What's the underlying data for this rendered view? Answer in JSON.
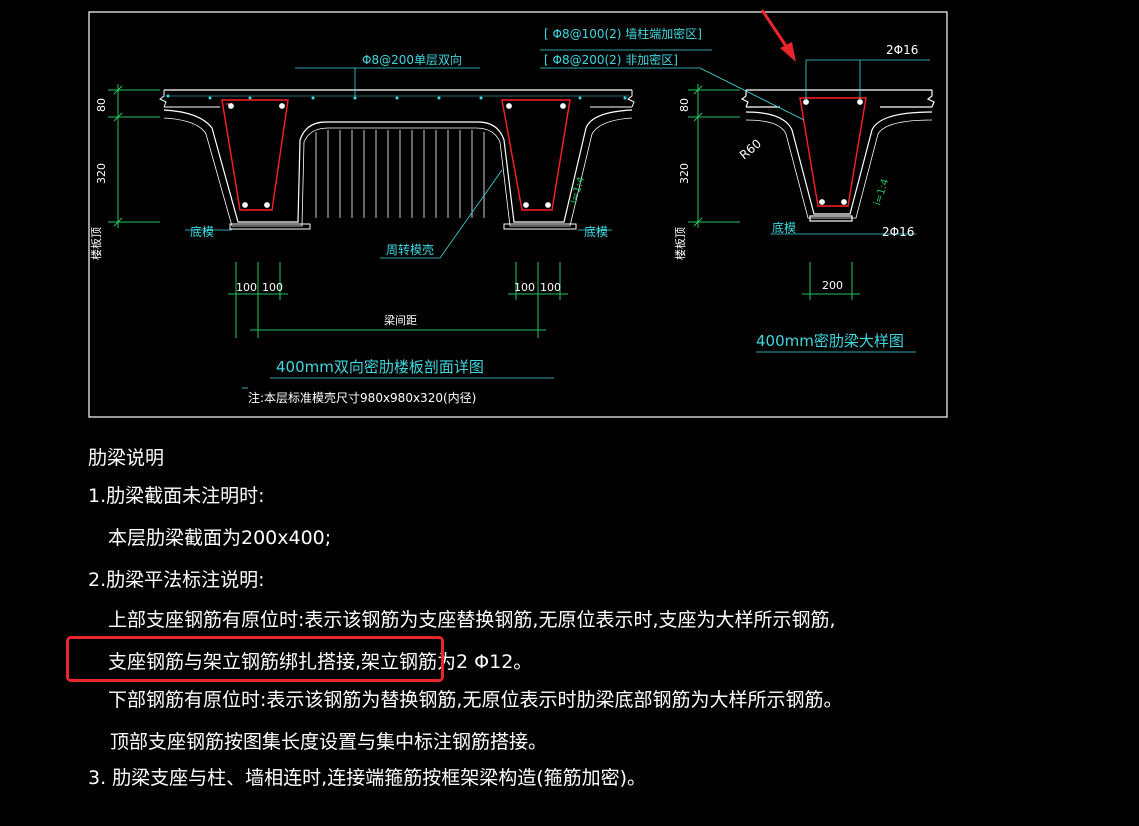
{
  "drawing": {
    "stirrup_dense_label": "[ Φ8@100(2)   墙柱端加密区]",
    "stirrup_normal_label": "[ Φ8@200(2)   非加密区]",
    "top_mesh_label": "Φ8@200单层双向",
    "top_bar_label": "2Φ16",
    "bottom_bar_label": "2Φ16",
    "radius_label": "R60",
    "slope_label": "i=1:4",
    "dim_80": "80",
    "dim_320": "320",
    "dim_100": "100",
    "dim_200": "200",
    "bottom_form_label": "底模",
    "cycle_mold_label": "周转模壳",
    "beam_spacing_label": "梁间距",
    "floor_level_label": "楼板顶",
    "section_title": "400mm双向密肋楼板剖面详图",
    "detail_title": "400mm密肋梁大样图",
    "mold_note": "注:本层标准模壳尺寸980x980x320(内径)"
  },
  "notes": {
    "heading": "肋梁说明",
    "item1": "1.肋梁截面未注明时:",
    "item1_sub": "本层肋梁截面为200x400;",
    "item2": "2.肋梁平法标注说明:",
    "item2_line1": "上部支座钢筋有原位时:表示该钢筋为支座替换钢筋,无原位表示时,支座为大样所示钢筋,",
    "item2_line2": "支座钢筋与架立钢筋绑扎搭接,架立钢筋为2 Φ12。",
    "item2_line3": "下部钢筋有原位时:表示该钢筋为替换钢筋,无原位表示时肋梁底部钢筋为大样所示钢筋。",
    "item2_line4": "顶部支座钢筋按图集长度设置与集中标注钢筋搭接。",
    "item3": "3. 肋梁支座与柱、墙相连时,连接端箍筋按框架梁构造(箍筋加密)。"
  },
  "colors": {
    "background": "#000000",
    "frame": "#ffffff",
    "concrete": "#ffffff",
    "rebar": "#ff2020",
    "dimension": "#22c55e",
    "annotation": "#3fd8e0",
    "highlight": "#e8262b"
  }
}
